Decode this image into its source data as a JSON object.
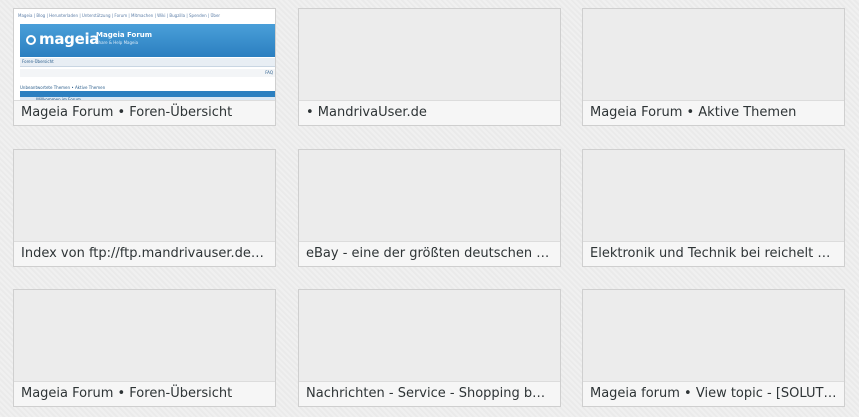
{
  "tiles": [
    {
      "title": "Mageia Forum • Foren-Übersicht",
      "has_preview": true
    },
    {
      "title": "• MandrivaUser.de",
      "has_preview": false
    },
    {
      "title": "Mageia Forum • Aktive Themen",
      "has_preview": false
    },
    {
      "title": "Index von ftp://ftp.mandrivauser.de/m...",
      "has_preview": false
    },
    {
      "title": "eBay - eine der größten deutschen S...",
      "has_preview": false
    },
    {
      "title": "Elektronik und Technik bei reichelt el...",
      "has_preview": false
    },
    {
      "title": "Mageia Forum • Foren-Übersicht",
      "has_preview": false
    },
    {
      "title": "Nachrichten - Service - Shopping bei ...",
      "has_preview": false
    },
    {
      "title": "Mageia forum • View topic - [SOLUTIO...",
      "has_preview": false
    }
  ],
  "preview": {
    "topnav": "Mageia  |  Blog  |  Herunterladen  |  Unterstützung  |  Forum  |  Mitmachen  |  Wiki  |  Bugzilla  |  Spenden  |  Über",
    "logo": "mageia",
    "forum_title": "Mageia Forum",
    "forum_subtitle": "Share & Help Mageia",
    "breadcrumb": "Foren-Übersicht",
    "faq": "FAQ",
    "links": "Unbeantwortete Themen • Aktive Themen",
    "row": "Willkommen im Forum"
  }
}
